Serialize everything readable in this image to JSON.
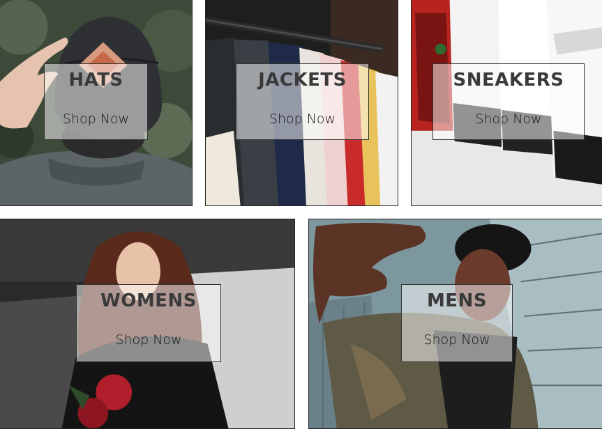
{
  "categories": [
    {
      "id": "hats",
      "title": "HATS",
      "cta": "Shop Now"
    },
    {
      "id": "jackets",
      "title": "JACKETS",
      "cta": "Shop Now"
    },
    {
      "id": "sneakers",
      "title": "SNEAKERS",
      "cta": "Shop Now"
    },
    {
      "id": "womens",
      "title": "WOMENS",
      "cta": "Shop Now"
    },
    {
      "id": "mens",
      "title": "MENS",
      "cta": "Shop Now"
    }
  ],
  "colors": {
    "card_overlay": "#ffffff",
    "title_text": "#3a3a3a",
    "cta_text": "#151515",
    "border": "#222222"
  }
}
